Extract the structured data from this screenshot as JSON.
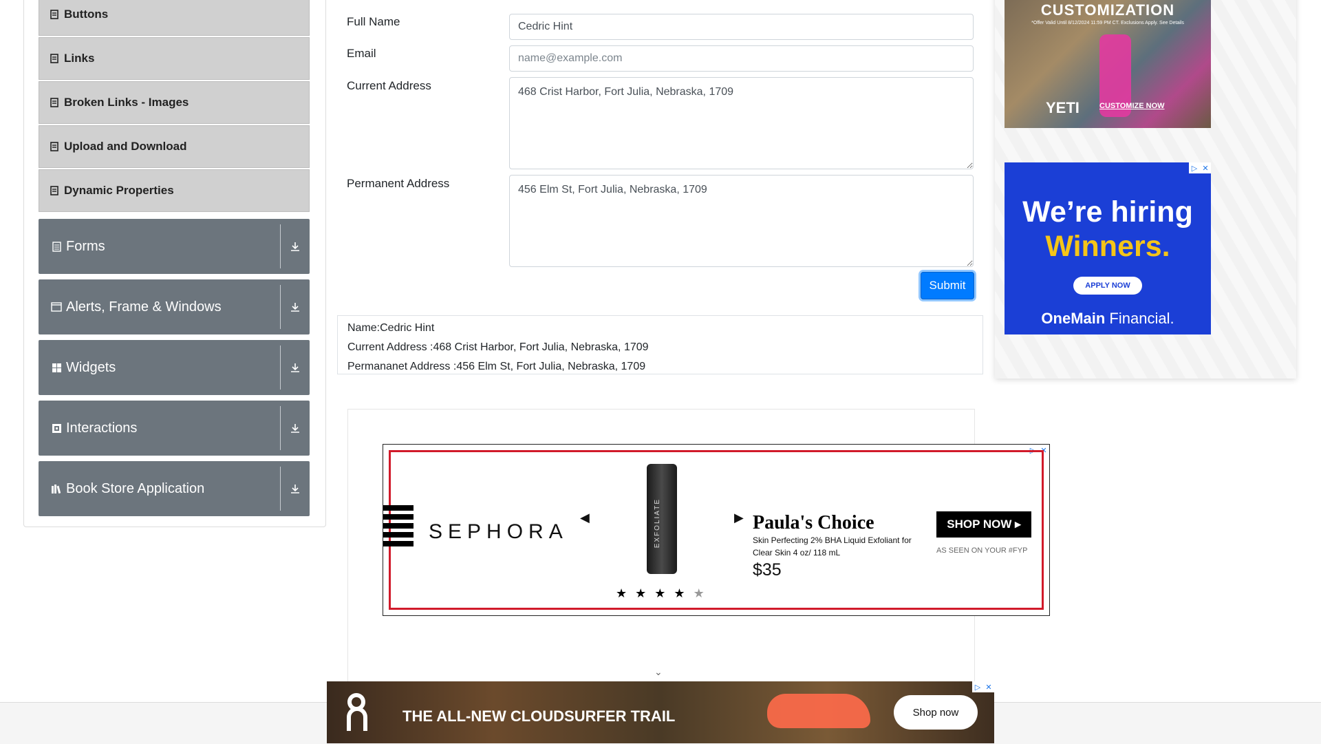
{
  "sidebar": {
    "sub_items": [
      {
        "label": "Buttons"
      },
      {
        "label": "Links"
      },
      {
        "label": "Broken Links - Images"
      },
      {
        "label": "Upload and Download"
      },
      {
        "label": "Dynamic Properties"
      }
    ],
    "groups": [
      {
        "label": "Forms",
        "icon": "document-icon"
      },
      {
        "label": "Alerts, Frame & Windows",
        "icon": "window-icon"
      },
      {
        "label": "Widgets",
        "icon": "widgets-icon"
      },
      {
        "label": "Interactions",
        "icon": "interactions-icon"
      },
      {
        "label": "Book Store Application",
        "icon": "books-icon"
      }
    ]
  },
  "form": {
    "full_name_label": "Full Name",
    "full_name_value": "Cedric Hint",
    "email_label": "Email",
    "email_placeholder": "name@example.com",
    "email_value": "",
    "current_address_label": "Current Address",
    "current_address_value": "468 Crist Harbor, Fort Julia, Nebraska, 1709",
    "permanent_address_label": "Permanent Address",
    "permanent_address_value": "456 Elm St, Fort Julia, Nebraska, 1709",
    "submit_label": "Submit"
  },
  "output": {
    "name": "Name:Cedric Hint",
    "current_address": "Current Address :468 Crist Harbor, Fort Julia, Nebraska, 1709",
    "permanent_address": "Permananet Address :456 Elm St, Fort Julia, Nebraska, 1709"
  },
  "ads": {
    "yeti": {
      "headline": "CUSTOMIZATION",
      "fine_print": "*Offer Valid Until 8/12/2024 11:59 PM CT. Exclusions Apply. See Details",
      "logo": "YETI",
      "cta": "CUSTOMIZE NOW"
    },
    "onemain": {
      "line1": "We’re hiring",
      "line2": "Winners.",
      "apply": "APPLY NOW",
      "brand_bold": "OneMain",
      "brand_rest": " Financial."
    },
    "sephora": {
      "logo": "SEPHORA",
      "bottle_text": "EXFOLIATE",
      "brand": "Paula's Choice",
      "desc": "Skin Perfecting 2% BHA Liquid Exfoliant for Clear Skin 4 oz/ 118 mL",
      "price": "$35",
      "shop": "SHOP NOW ▸",
      "seen": "AS SEEN ON YOUR #FYP",
      "rating": 4,
      "rating_max": 5
    },
    "on": {
      "headline": "THE ALL-NEW CLOUDSURFER TRAIL",
      "shop": "Shop now"
    },
    "adchoices": {
      "play": "▷",
      "close": "✕"
    }
  }
}
